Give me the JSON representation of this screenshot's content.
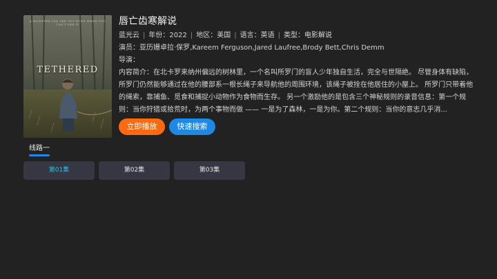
{
  "detail": {
    "title": "唇亡齿寒解说",
    "source": "蓝光云",
    "year_label": "年份",
    "year": "2022",
    "region_label": "地区",
    "region": "美国",
    "language_label": "语言",
    "language": "英语",
    "genre_label": "类型",
    "genre": "电影解说",
    "cast_label": "演员",
    "cast": "亚历姗卓拉·保罗,Kareem Ferguson,Jared Laufree,Brody Bett,Chris Demm",
    "director_label": "导演",
    "director": "",
    "synopsis_label": "内容简介",
    "synopsis": "在北卡罗来纳州偏远的树林里，一个名叫所罗门的盲人少年独自生活，完全与世隔绝。 尽管身体有缺陷，所罗门仍然能够通过在他的腰部系一根长绳子来导航他的周围环境，该绳子被拴在他居住的小屋上。 所罗门只带着他的绳索，靠捕鱼、觅食和捕捉小动物作为食物而生存。 另一个激励他的是包含三个神秘规则的录音信息：第一个规则：当你狩猎或拾荒时，为两个事物而做 —— 一是为了森林，一是为你。第二个规则：当你的意志几乎消..."
  },
  "poster": {
    "title": "TETHERED",
    "tagline": "A MONSTER CAN SEE YOU EVEN WHEN YOU CAN'T SEE IT"
  },
  "actions": {
    "play_label": "立即播放",
    "search_label": "快速搜索"
  },
  "lines": {
    "active_label": "线路一"
  },
  "episodes": [
    {
      "label": "第01集",
      "active": true
    },
    {
      "label": "第02集",
      "active": false
    },
    {
      "label": "第03集",
      "active": false
    }
  ],
  "colors": {
    "background": "#222222",
    "play_button": "#ff6a10",
    "search_button": "#1e88e5",
    "episode_bg": "#373744",
    "episode_active_text": "#1fc6e8",
    "tab_underline": "#1e88e5"
  }
}
